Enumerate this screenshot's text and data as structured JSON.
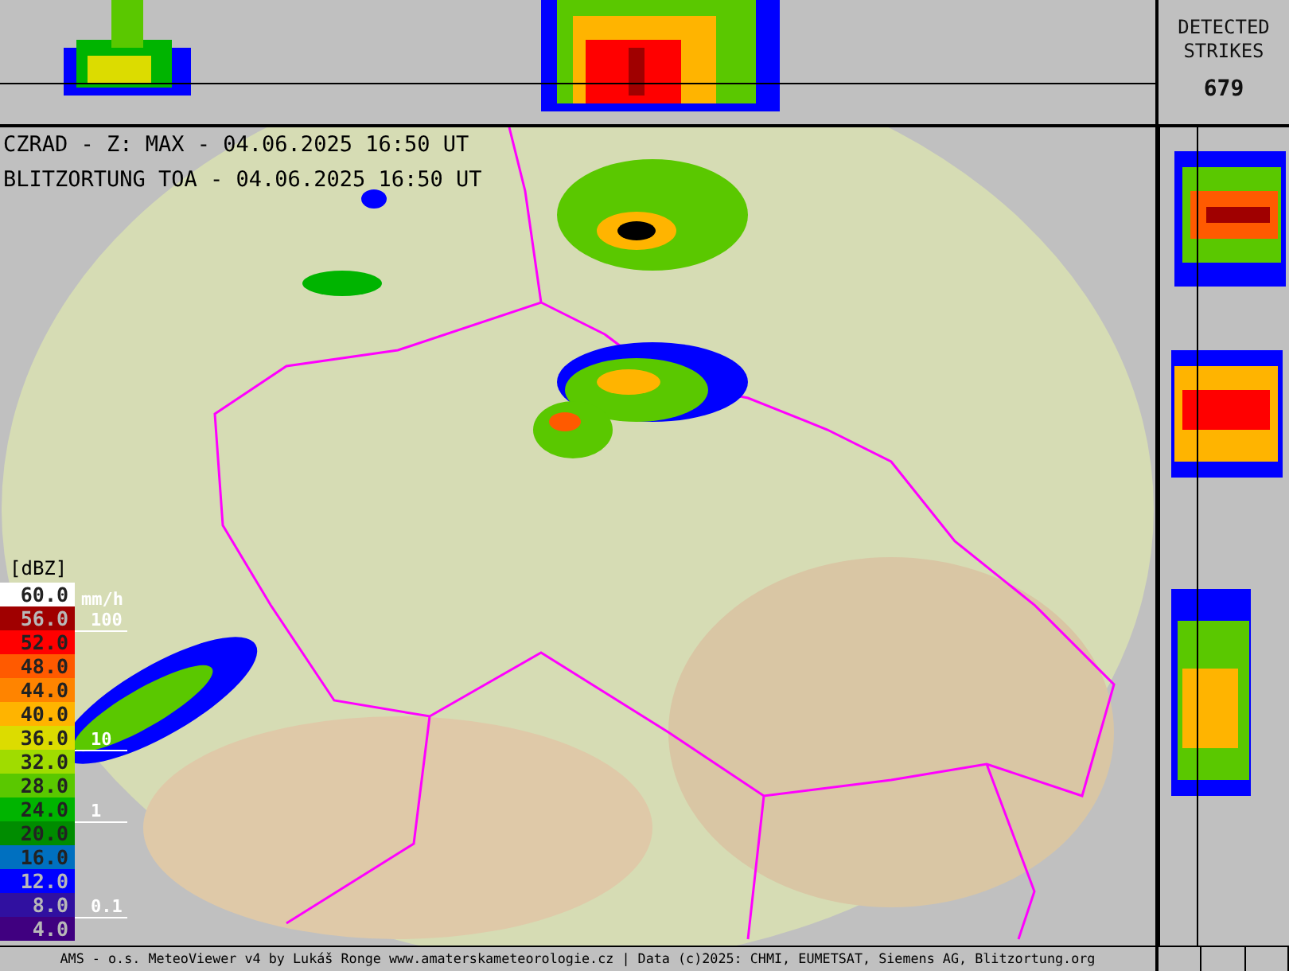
{
  "titles": [
    "CZRAD - Z: MAX - 04.06.2025 16:50 UT",
    "BLITZORTUNG TOA - 04.06.2025 16:50 UT"
  ],
  "strikes": {
    "label": "DETECTED STRIKES",
    "count": "679"
  },
  "legend": {
    "unit": "[dBZ]",
    "rain_unit": "mm/h",
    "rows": [
      {
        "value": "60.0",
        "color": "#ffffff"
      },
      {
        "value": "56.0",
        "color": "#a00000",
        "rain_mark": "100"
      },
      {
        "value": "52.0",
        "color": "#ff0000"
      },
      {
        "value": "48.0",
        "color": "#ff5a00"
      },
      {
        "value": "44.0",
        "color": "#ff8400"
      },
      {
        "value": "40.0",
        "color": "#ffb400"
      },
      {
        "value": "36.0",
        "color": "#dcdc00",
        "rain_mark": "10"
      },
      {
        "value": "32.0",
        "color": "#a0dc00"
      },
      {
        "value": "28.0",
        "color": "#5ac800"
      },
      {
        "value": "24.0",
        "color": "#00b400",
        "rain_mark": "1"
      },
      {
        "value": "20.0",
        "color": "#008c00"
      },
      {
        "value": "16.0",
        "color": "#0070c0"
      },
      {
        "value": "12.0",
        "color": "#0000ff"
      },
      {
        "value": "8.0",
        "color": "#3010a0",
        "rain_mark": "0.1"
      },
      {
        "value": "4.0",
        "color": "#400080"
      }
    ]
  },
  "footer": "AMS - o.s. MeteoViewer v4 by Lukáš Ronge www.amaterskameteorologie.cz | Data (c)2025: CHMI, EUMETSAT, Siemens AG, Blitzortung.org"
}
